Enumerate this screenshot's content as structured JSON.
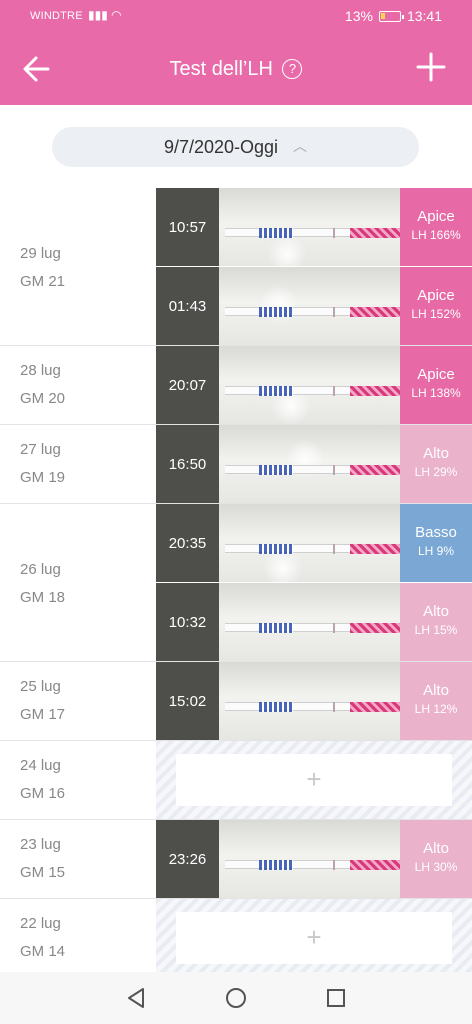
{
  "status_bar": {
    "carrier": "WINDTRE",
    "battery": "13%",
    "time": "13:41"
  },
  "header": {
    "title": "Test dell’LH",
    "help_icon": "?",
    "back_icon": "arrow-left-icon",
    "add_icon": "plus-icon"
  },
  "filter": {
    "range": "9/7/2020-Oggi",
    "chevron": "chevron-up-icon"
  },
  "days": [
    {
      "date": "29 lug",
      "cycle_day": "GM 21"
    },
    {
      "date": "28 lug",
      "cycle_day": "GM 20"
    },
    {
      "date": "27 lug",
      "cycle_day": "GM 19"
    },
    {
      "date": "26 lug",
      "cycle_day": "GM 18"
    },
    {
      "date": "25 lug",
      "cycle_day": "GM 17"
    },
    {
      "date": "24 lug",
      "cycle_day": "GM 16"
    },
    {
      "date": "23 lug",
      "cycle_day": "GM 15"
    },
    {
      "date": "22 lug",
      "cycle_day": "GM 14"
    }
  ],
  "entries": [
    {
      "time": "10:57",
      "level": "Apice",
      "lh": "LH 166%"
    },
    {
      "time": "01:43",
      "level": "Apice",
      "lh": "LH 152%"
    },
    {
      "time": "20:07",
      "level": "Apice",
      "lh": "LH 138%"
    },
    {
      "time": "16:50",
      "level": "Alto",
      "lh": "LH 29%"
    },
    {
      "time": "20:35",
      "level": "Basso",
      "lh": "LH 9%"
    },
    {
      "time": "10:32",
      "level": "Alto",
      "lh": "LH 15%"
    },
    {
      "time": "15:02",
      "level": "Alto",
      "lh": "LH 12%"
    },
    {
      "time": "23:26",
      "level": "Alto",
      "lh": "LH 30%"
    }
  ],
  "empty_add_symbol": "+",
  "colors": {
    "header": "#e96aa8",
    "apice": "#e76aa6",
    "alto": "#eab2cb",
    "basso": "#7aa7d3"
  }
}
